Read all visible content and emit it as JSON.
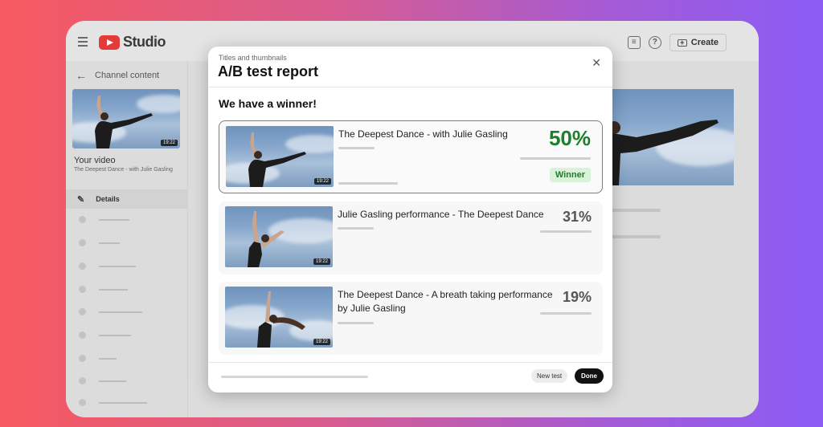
{
  "app": {
    "logo_text": "Studio",
    "create_label": "Create",
    "feedback_icon": "feedback-icon",
    "help_icon": "help-icon",
    "create_icon": "video-plus-icon"
  },
  "sidebar": {
    "back_label": "Channel content",
    "your_video_label": "Your video",
    "video_subtitle": "The Deepest Dance - with Julie Gasling",
    "thumb_duration": "19:22",
    "details_label": "Details"
  },
  "modal": {
    "subtitle": "Titles and thumbnails",
    "title": "A/B test report",
    "heading": "We have a winner!",
    "results": [
      {
        "title": "The Deepest Dance - with Julie Gasling",
        "percent": "50%",
        "duration": "19:22",
        "badge": "Winner"
      },
      {
        "title": "Julie Gasling performance - The Deepest Dance",
        "percent": "31%",
        "duration": "19:22"
      },
      {
        "title": "The Deepest Dance - A breath taking performance by Julie Gasling",
        "percent": "19%",
        "duration": "19:22"
      }
    ],
    "new_test_label": "New test",
    "done_label": "Done"
  },
  "colors": {
    "winner_green": "#1d7f2a",
    "winner_badge_bg": "#d9f3da",
    "logo_red": "#e43a3a"
  }
}
